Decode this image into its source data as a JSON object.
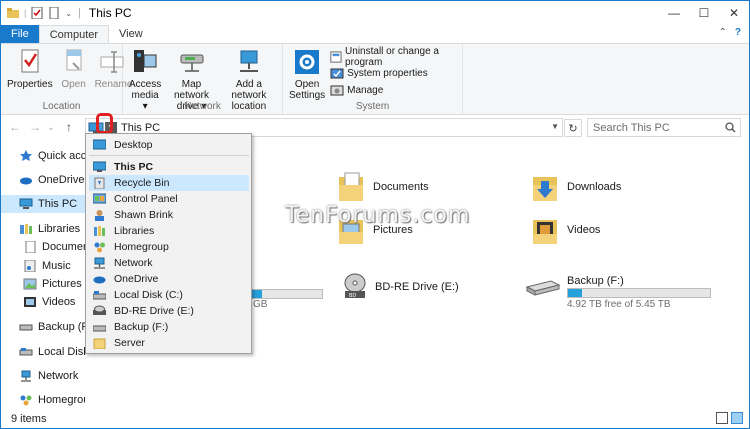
{
  "window": {
    "title": "This PC"
  },
  "tabs": [
    "File",
    "Computer",
    "View"
  ],
  "ribbon": {
    "location": {
      "label": "Location",
      "buttons": [
        "Properties",
        "Open",
        "Rename"
      ]
    },
    "network": {
      "label": "Network",
      "buttons": [
        {
          "line1": "Access",
          "line2": "media ▾"
        },
        {
          "line1": "Map network",
          "line2": "drive ▾"
        },
        {
          "line1": "Add a network",
          "line2": "location"
        }
      ]
    },
    "system": {
      "label": "System",
      "open_settings": {
        "line1": "Open",
        "line2": "Settings"
      },
      "items": [
        "Uninstall or change a program",
        "System properties",
        "Manage"
      ]
    }
  },
  "address": {
    "path": "This PC"
  },
  "search": {
    "placeholder": "Search This PC"
  },
  "nav": [
    {
      "label": "Quick access",
      "icon": "star-icon"
    },
    {
      "label": "OneDrive",
      "icon": "cloud-icon"
    },
    {
      "label": "This PC",
      "icon": "computer-icon"
    },
    {
      "label": "Libraries",
      "icon": "library-icon"
    },
    {
      "label": "Documents",
      "icon": "documents-icon"
    },
    {
      "label": "Music",
      "icon": "music-icon"
    },
    {
      "label": "Pictures",
      "icon": "pictures-icon"
    },
    {
      "label": "Videos",
      "icon": "videos-icon"
    },
    {
      "label": "Backup (F:)",
      "icon": "drive-icon"
    },
    {
      "label": "Local Disk (C:)",
      "icon": "disk-icon"
    },
    {
      "label": "Network",
      "icon": "network-icon"
    },
    {
      "label": "Homegroup",
      "icon": "homegroup-icon"
    }
  ],
  "dropdown": [
    {
      "label": "Desktop",
      "icon": "desktop-icon"
    },
    {
      "label": "This PC",
      "icon": "computer-icon"
    },
    {
      "label": "Recycle Bin",
      "icon": "recycle-bin-icon"
    },
    {
      "label": "Control Panel",
      "icon": "control-panel-icon"
    },
    {
      "label": "Shawn Brink",
      "icon": "user-icon"
    },
    {
      "label": "Libraries",
      "icon": "library-icon"
    },
    {
      "label": "Homegroup",
      "icon": "homegroup-icon"
    },
    {
      "label": "Network",
      "icon": "network-icon"
    },
    {
      "label": "OneDrive",
      "icon": "cloud-icon"
    },
    {
      "label": "Local Disk (C:)",
      "icon": "disk-icon"
    },
    {
      "label": "BD-RE Drive (E:)",
      "icon": "disc-drive-icon"
    },
    {
      "label": "Backup (F:)",
      "icon": "drive-icon"
    },
    {
      "label": "Server",
      "icon": "folder-icon"
    }
  ],
  "folders": [
    {
      "label": "Documents",
      "icon": "documents-folder-icon"
    },
    {
      "label": "Downloads",
      "icon": "downloads-folder-icon"
    },
    {
      "label": "Pictures",
      "icon": "pictures-folder-icon"
    },
    {
      "label": "Videos",
      "icon": "videos-folder-icon"
    }
  ],
  "drives": {
    "local_c": {
      "size_suffix": "GB"
    },
    "bd": {
      "label": "BD-RE Drive (E:)"
    },
    "backup": {
      "label": "Backup (F:)",
      "free": "4.92 TB free of 5.45 TB",
      "used_fraction": 0.1
    }
  },
  "watermark": "TenForums.com",
  "status": {
    "items": "9 items"
  },
  "colors": {
    "accent": "#1979ca",
    "selection": "#cce8ff",
    "drive_fill": "#26a0da"
  }
}
